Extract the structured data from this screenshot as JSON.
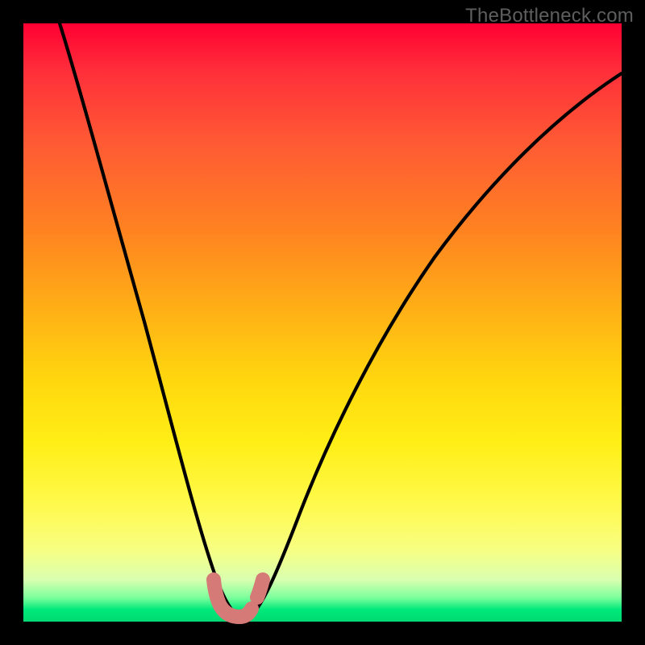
{
  "watermark": "TheBottleneck.com",
  "colors": {
    "frame_border": "#000000",
    "watermark_text": "#5e5e5e",
    "curve": "#000000",
    "marker": "#d67a78",
    "gradient_top": "#ff0033",
    "gradient_bottom": "#00da72"
  },
  "chart_data": {
    "type": "line",
    "title": "",
    "xlabel": "",
    "ylabel": "",
    "xlim": [
      0,
      100
    ],
    "ylim": [
      0,
      100
    ],
    "grid": false,
    "legend": false,
    "annotations": [],
    "series": [
      {
        "name": "bottleneck-curve",
        "x": [
          6,
          8,
          10,
          12,
          15,
          18,
          21,
          24,
          27,
          29,
          31,
          32.5,
          34,
          35,
          36,
          37,
          38,
          39,
          41,
          44,
          48,
          53,
          58,
          64,
          70,
          76,
          82,
          88,
          94,
          100
        ],
        "y": [
          100,
          90,
          80,
          71,
          58,
          47,
          36,
          26,
          17,
          11,
          6,
          3,
          1.5,
          1,
          1,
          1.2,
          2,
          4,
          8,
          15,
          24,
          34,
          43,
          52,
          60,
          67,
          73,
          78,
          82,
          85
        ]
      }
    ],
    "highlight": {
      "name": "optimal-range-marker",
      "points": [
        {
          "x": 31.5,
          "y": 5.5
        },
        {
          "x": 32.0,
          "y": 3.0
        },
        {
          "x": 33.0,
          "y": 1.3
        },
        {
          "x": 35.0,
          "y": 1.0
        },
        {
          "x": 36.8,
          "y": 1.2
        },
        {
          "x": 37.6,
          "y": 2.8
        },
        {
          "x": 38.2,
          "y": 5.5
        }
      ]
    }
  }
}
